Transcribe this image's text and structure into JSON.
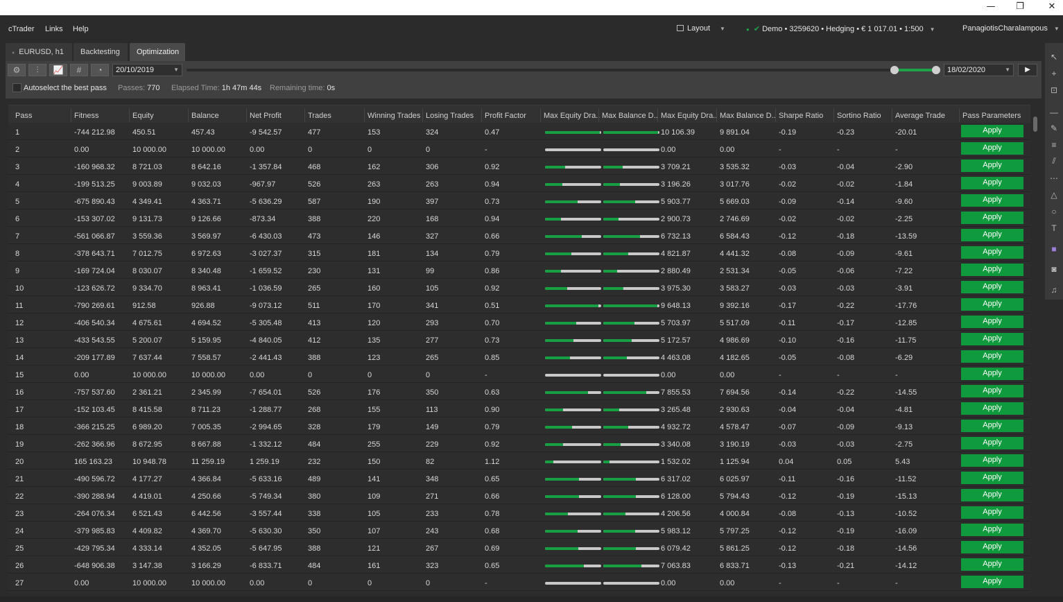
{
  "window": {
    "minimize": "—",
    "restore": "❐",
    "close": "✕"
  },
  "menu": {
    "items": [
      "cTrader",
      "Links",
      "Help"
    ]
  },
  "header": {
    "layout_label": "Layout",
    "account": "Demo • 3259620 • Hedging • € 1 017.01 • 1:500",
    "user": "PanagiotisCharalampous"
  },
  "tabs": [
    {
      "label": "EURUSD, h1",
      "active": false
    },
    {
      "label": "Backtesting",
      "active": false
    },
    {
      "label": "Optimization",
      "active": true
    }
  ],
  "toolbar": {
    "icons": [
      "settings-icon",
      "parameters-icon",
      "equity-chart-icon",
      "hash-icon",
      "speed-gauge-icon"
    ],
    "start_date": "20/10/2019",
    "end_date": "18/02/2020",
    "autoselect_label": "Autoselect the best pass",
    "passes_label": "Passes:",
    "passes_value": "770",
    "elapsed_label": "Elapsed Time:",
    "elapsed_value": "1h 47m 44s",
    "remaining_label": "Remaining time:",
    "remaining_value": "0s"
  },
  "table": {
    "columns": [
      "Pass",
      "Fitness",
      "Equity",
      "Balance",
      "Net Profit",
      "Trades",
      "Winning Trades",
      "Losing Trades",
      "Profit Factor",
      "Max Equity Dra..",
      "Max Balance D..",
      "Max Equity Dra..",
      "Max Balance D..",
      "Sharpe Ratio",
      "Sortino Ratio",
      "Average Trade",
      "Pass Parameters"
    ],
    "apply_label": "Apply",
    "rows": [
      {
        "pass": "1",
        "fitness": "-744 212.98",
        "equity": "450.51",
        "balance": "457.43",
        "net_profit": "-9 542.57",
        "trades": "477",
        "winning": "153",
        "losing": "324",
        "pf": "0.47",
        "eq_dd_pct": 0.98,
        "bal_dd_pct": 0.97,
        "max_eq_dd": "10 106.39",
        "max_bal_dd": "9 891.04",
        "sharpe": "-0.19",
        "sortino": "-0.23",
        "avg_trade": "-20.01"
      },
      {
        "pass": "2",
        "fitness": "0.00",
        "equity": "10 000.00",
        "balance": "10 000.00",
        "net_profit": "0.00",
        "trades": "0",
        "winning": "0",
        "losing": "0",
        "pf": "-",
        "eq_dd_pct": 0,
        "bal_dd_pct": 0,
        "max_eq_dd": "0.00",
        "max_bal_dd": "0.00",
        "sharpe": "-",
        "sortino": "-",
        "avg_trade": "-"
      },
      {
        "pass": "3",
        "fitness": "-160 968.32",
        "equity": "8 721.03",
        "balance": "8 642.16",
        "net_profit": "-1 357.84",
        "trades": "468",
        "winning": "162",
        "losing": "306",
        "pf": "0.92",
        "eq_dd_pct": 0.36,
        "bal_dd_pct": 0.35,
        "max_eq_dd": "3 709.21",
        "max_bal_dd": "3 535.32",
        "sharpe": "-0.03",
        "sortino": "-0.04",
        "avg_trade": "-2.90"
      },
      {
        "pass": "4",
        "fitness": "-199 513.25",
        "equity": "9 003.89",
        "balance": "9 032.03",
        "net_profit": "-967.97",
        "trades": "526",
        "winning": "263",
        "losing": "263",
        "pf": "0.94",
        "eq_dd_pct": 0.31,
        "bal_dd_pct": 0.3,
        "max_eq_dd": "3 196.26",
        "max_bal_dd": "3 017.76",
        "sharpe": "-0.02",
        "sortino": "-0.02",
        "avg_trade": "-1.84"
      },
      {
        "pass": "5",
        "fitness": "-675 890.43",
        "equity": "4 349.41",
        "balance": "4 363.71",
        "net_profit": "-5 636.29",
        "trades": "587",
        "winning": "190",
        "losing": "397",
        "pf": "0.73",
        "eq_dd_pct": 0.58,
        "bal_dd_pct": 0.57,
        "max_eq_dd": "5 903.77",
        "max_bal_dd": "5 669.03",
        "sharpe": "-0.09",
        "sortino": "-0.14",
        "avg_trade": "-9.60"
      },
      {
        "pass": "6",
        "fitness": "-153 307.02",
        "equity": "9 131.73",
        "balance": "9 126.66",
        "net_profit": "-873.34",
        "trades": "388",
        "winning": "220",
        "losing": "168",
        "pf": "0.94",
        "eq_dd_pct": 0.28,
        "bal_dd_pct": 0.27,
        "max_eq_dd": "2 900.73",
        "max_bal_dd": "2 746.69",
        "sharpe": "-0.02",
        "sortino": "-0.02",
        "avg_trade": "-2.25"
      },
      {
        "pass": "7",
        "fitness": "-561 066.87",
        "equity": "3 559.36",
        "balance": "3 569.97",
        "net_profit": "-6 430.03",
        "trades": "473",
        "winning": "146",
        "losing": "327",
        "pf": "0.66",
        "eq_dd_pct": 0.65,
        "bal_dd_pct": 0.66,
        "max_eq_dd": "6 732.13",
        "max_bal_dd": "6 584.43",
        "sharpe": "-0.12",
        "sortino": "-0.18",
        "avg_trade": "-13.59"
      },
      {
        "pass": "8",
        "fitness": "-378 643.71",
        "equity": "7 012.75",
        "balance": "6 972.63",
        "net_profit": "-3 027.37",
        "trades": "315",
        "winning": "181",
        "losing": "134",
        "pf": "0.79",
        "eq_dd_pct": 0.47,
        "bal_dd_pct": 0.44,
        "max_eq_dd": "4 821.87",
        "max_bal_dd": "4 441.32",
        "sharpe": "-0.08",
        "sortino": "-0.09",
        "avg_trade": "-9.61"
      },
      {
        "pass": "9",
        "fitness": "-169 724.04",
        "equity": "8 030.07",
        "balance": "8 340.48",
        "net_profit": "-1 659.52",
        "trades": "230",
        "winning": "131",
        "losing": "99",
        "pf": "0.86",
        "eq_dd_pct": 0.28,
        "bal_dd_pct": 0.25,
        "max_eq_dd": "2 880.49",
        "max_bal_dd": "2 531.34",
        "sharpe": "-0.05",
        "sortino": "-0.06",
        "avg_trade": "-7.22"
      },
      {
        "pass": "10",
        "fitness": "-123 626.72",
        "equity": "9 334.70",
        "balance": "8 963.41",
        "net_profit": "-1 036.59",
        "trades": "265",
        "winning": "160",
        "losing": "105",
        "pf": "0.92",
        "eq_dd_pct": 0.39,
        "bal_dd_pct": 0.36,
        "max_eq_dd": "3 975.30",
        "max_bal_dd": "3 583.27",
        "sharpe": "-0.03",
        "sortino": "-0.03",
        "avg_trade": "-3.91"
      },
      {
        "pass": "11",
        "fitness": "-790 269.61",
        "equity": "912.58",
        "balance": "926.88",
        "net_profit": "-9 073.12",
        "trades": "511",
        "winning": "170",
        "losing": "341",
        "pf": "0.51",
        "eq_dd_pct": 0.95,
        "bal_dd_pct": 0.96,
        "max_eq_dd": "9 648.13",
        "max_bal_dd": "9 392.16",
        "sharpe": "-0.17",
        "sortino": "-0.22",
        "avg_trade": "-17.76"
      },
      {
        "pass": "12",
        "fitness": "-406 540.34",
        "equity": "4 675.61",
        "balance": "4 694.52",
        "net_profit": "-5 305.48",
        "trades": "413",
        "winning": "120",
        "losing": "293",
        "pf": "0.70",
        "eq_dd_pct": 0.56,
        "bal_dd_pct": 0.55,
        "max_eq_dd": "5 703.97",
        "max_bal_dd": "5 517.09",
        "sharpe": "-0.11",
        "sortino": "-0.17",
        "avg_trade": "-12.85"
      },
      {
        "pass": "13",
        "fitness": "-433 543.55",
        "equity": "5 200.07",
        "balance": "5 159.95",
        "net_profit": "-4 840.05",
        "trades": "412",
        "winning": "135",
        "losing": "277",
        "pf": "0.73",
        "eq_dd_pct": 0.51,
        "bal_dd_pct": 0.5,
        "max_eq_dd": "5 172.57",
        "max_bal_dd": "4 986.69",
        "sharpe": "-0.10",
        "sortino": "-0.16",
        "avg_trade": "-11.75"
      },
      {
        "pass": "14",
        "fitness": "-209 177.89",
        "equity": "7 637.44",
        "balance": "7 558.57",
        "net_profit": "-2 441.43",
        "trades": "388",
        "winning": "123",
        "losing": "265",
        "pf": "0.85",
        "eq_dd_pct": 0.44,
        "bal_dd_pct": 0.42,
        "max_eq_dd": "4 463.08",
        "max_bal_dd": "4 182.65",
        "sharpe": "-0.05",
        "sortino": "-0.08",
        "avg_trade": "-6.29"
      },
      {
        "pass": "15",
        "fitness": "0.00",
        "equity": "10 000.00",
        "balance": "10 000.00",
        "net_profit": "0.00",
        "trades": "0",
        "winning": "0",
        "losing": "0",
        "pf": "-",
        "eq_dd_pct": 0,
        "bal_dd_pct": 0,
        "max_eq_dd": "0.00",
        "max_bal_dd": "0.00",
        "sharpe": "-",
        "sortino": "-",
        "avg_trade": "-"
      },
      {
        "pass": "16",
        "fitness": "-757 537.60",
        "equity": "2 361.21",
        "balance": "2 345.99",
        "net_profit": "-7 654.01",
        "trades": "526",
        "winning": "176",
        "losing": "350",
        "pf": "0.63",
        "eq_dd_pct": 0.77,
        "bal_dd_pct": 0.76,
        "max_eq_dd": "7 855.53",
        "max_bal_dd": "7 694.56",
        "sharpe": "-0.14",
        "sortino": "-0.22",
        "avg_trade": "-14.55"
      },
      {
        "pass": "17",
        "fitness": "-152 103.45",
        "equity": "8 415.58",
        "balance": "8 711.23",
        "net_profit": "-1 288.77",
        "trades": "268",
        "winning": "155",
        "losing": "113",
        "pf": "0.90",
        "eq_dd_pct": 0.32,
        "bal_dd_pct": 0.29,
        "max_eq_dd": "3 265.48",
        "max_bal_dd": "2 930.63",
        "sharpe": "-0.04",
        "sortino": "-0.04",
        "avg_trade": "-4.81"
      },
      {
        "pass": "18",
        "fitness": "-366 215.25",
        "equity": "6 989.20",
        "balance": "7 005.35",
        "net_profit": "-2 994.65",
        "trades": "328",
        "winning": "179",
        "losing": "149",
        "pf": "0.79",
        "eq_dd_pct": 0.48,
        "bal_dd_pct": 0.45,
        "max_eq_dd": "4 932.72",
        "max_bal_dd": "4 578.47",
        "sharpe": "-0.07",
        "sortino": "-0.09",
        "avg_trade": "-9.13"
      },
      {
        "pass": "19",
        "fitness": "-262 366.96",
        "equity": "8 672.95",
        "balance": "8 667.88",
        "net_profit": "-1 332.12",
        "trades": "484",
        "winning": "255",
        "losing": "229",
        "pf": "0.92",
        "eq_dd_pct": 0.32,
        "bal_dd_pct": 0.31,
        "max_eq_dd": "3 340.08",
        "max_bal_dd": "3 190.19",
        "sharpe": "-0.03",
        "sortino": "-0.03",
        "avg_trade": "-2.75"
      },
      {
        "pass": "20",
        "fitness": "165 163.23",
        "equity": "10 948.78",
        "balance": "11 259.19",
        "net_profit": "1 259.19",
        "trades": "232",
        "winning": "150",
        "losing": "82",
        "pf": "1.12",
        "eq_dd_pct": 0.15,
        "bal_dd_pct": 0.11,
        "max_eq_dd": "1 532.02",
        "max_bal_dd": "1 125.94",
        "sharpe": "0.04",
        "sortino": "0.05",
        "avg_trade": "5.43"
      },
      {
        "pass": "21",
        "fitness": "-490 596.72",
        "equity": "4 177.27",
        "balance": "4 366.84",
        "net_profit": "-5 633.16",
        "trades": "489",
        "winning": "141",
        "losing": "348",
        "pf": "0.65",
        "eq_dd_pct": 0.6,
        "bal_dd_pct": 0.58,
        "max_eq_dd": "6 317.02",
        "max_bal_dd": "6 025.97",
        "sharpe": "-0.11",
        "sortino": "-0.16",
        "avg_trade": "-11.52"
      },
      {
        "pass": "22",
        "fitness": "-390 288.94",
        "equity": "4 419.01",
        "balance": "4 250.66",
        "net_profit": "-5 749.34",
        "trades": "380",
        "winning": "109",
        "losing": "271",
        "pf": "0.66",
        "eq_dd_pct": 0.6,
        "bal_dd_pct": 0.58,
        "max_eq_dd": "6 128.00",
        "max_bal_dd": "5 794.43",
        "sharpe": "-0.12",
        "sortino": "-0.19",
        "avg_trade": "-15.13"
      },
      {
        "pass": "23",
        "fitness": "-264 076.34",
        "equity": "6 521.43",
        "balance": "6 442.56",
        "net_profit": "-3 557.44",
        "trades": "338",
        "winning": "105",
        "losing": "233",
        "pf": "0.78",
        "eq_dd_pct": 0.41,
        "bal_dd_pct": 0.4,
        "max_eq_dd": "4 206.56",
        "max_bal_dd": "4 000.84",
        "sharpe": "-0.08",
        "sortino": "-0.13",
        "avg_trade": "-10.52"
      },
      {
        "pass": "24",
        "fitness": "-379 985.83",
        "equity": "4 409.82",
        "balance": "4 369.70",
        "net_profit": "-5 630.30",
        "trades": "350",
        "winning": "107",
        "losing": "243",
        "pf": "0.68",
        "eq_dd_pct": 0.58,
        "bal_dd_pct": 0.57,
        "max_eq_dd": "5 983.12",
        "max_bal_dd": "5 797.25",
        "sharpe": "-0.12",
        "sortino": "-0.19",
        "avg_trade": "-16.09"
      },
      {
        "pass": "25",
        "fitness": "-429 795.34",
        "equity": "4 333.14",
        "balance": "4 352.05",
        "net_profit": "-5 647.95",
        "trades": "388",
        "winning": "121",
        "losing": "267",
        "pf": "0.69",
        "eq_dd_pct": 0.59,
        "bal_dd_pct": 0.58,
        "max_eq_dd": "6 079.42",
        "max_bal_dd": "5 861.25",
        "sharpe": "-0.12",
        "sortino": "-0.18",
        "avg_trade": "-14.56"
      },
      {
        "pass": "26",
        "fitness": "-648 906.38",
        "equity": "3 147.38",
        "balance": "3 166.29",
        "net_profit": "-6 833.71",
        "trades": "484",
        "winning": "161",
        "losing": "323",
        "pf": "0.65",
        "eq_dd_pct": 0.69,
        "bal_dd_pct": 0.68,
        "max_eq_dd": "7 063.83",
        "max_bal_dd": "6 833.71",
        "sharpe": "-0.13",
        "sortino": "-0.21",
        "avg_trade": "-14.12"
      },
      {
        "pass": "27",
        "fitness": "0.00",
        "equity": "10 000.00",
        "balance": "10 000.00",
        "net_profit": "0.00",
        "trades": "0",
        "winning": "0",
        "losing": "0",
        "pf": "-",
        "eq_dd_pct": 0,
        "bal_dd_pct": 0,
        "max_eq_dd": "0.00",
        "max_bal_dd": "0.00",
        "sharpe": "-",
        "sortino": "-",
        "avg_trade": "-"
      }
    ]
  },
  "right_tools": [
    "cursor-icon",
    "crosshair-icon",
    "zoom-icon",
    "line-icon",
    "pencil-icon",
    "fib-icon",
    "channel-icon",
    "grid-lines-icon",
    "triangle-icon",
    "circle-icon",
    "text-icon",
    "color-swatch-icon",
    "camera-icon",
    "alert-bell-icon"
  ],
  "colors": {
    "accent": "#0f9a3d",
    "bg": "#2b2b2b",
    "panel": "#404040"
  }
}
